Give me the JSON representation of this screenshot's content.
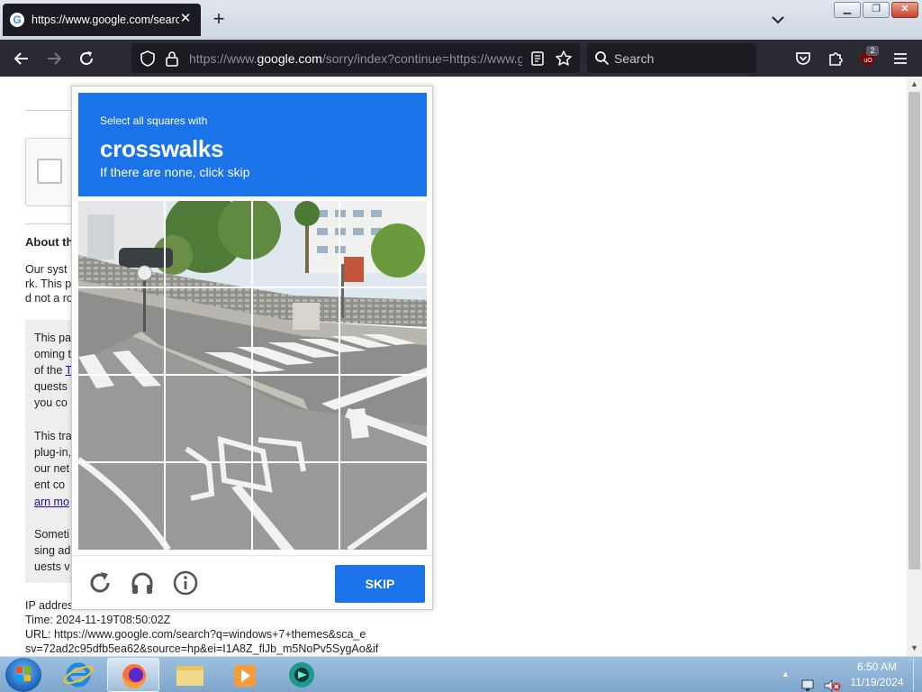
{
  "browser": {
    "tab": {
      "title": "https://www.google.com/search",
      "favicon": "G"
    },
    "url": {
      "prefix": "https://www.",
      "host": "google.com",
      "rest": "/sorry/index?continue=https://www.google.com/search"
    },
    "search_placeholder": "Search",
    "extension_badge": "2"
  },
  "page": {
    "heading": "About th",
    "para1": [
      "Our syst",
      "rk. This p",
      "d not a ro"
    ],
    "box_lines": [
      "This pa",
      "oming t",
      "of the ",
      "T",
      "quests",
      "you co",
      "",
      "This tra",
      "plug-in,",
      "our net",
      "ent co",
      "arn mo",
      "",
      "Someti",
      "sing ad",
      "uests v"
    ],
    "ip_line": "IP addres",
    "time_line": "Time: 2024-11-19T08:50:02Z",
    "url_line1": "URL: https://www.google.com/search?q=windows+7+themes&sca_e",
    "url_line2": "sv=72ad2c95dfb5ea62&source=hp&ei=I1A8Z_flJb_m5NoPv5SygAo&if"
  },
  "captcha": {
    "instruction_small": "Select all squares with",
    "target": "crosswalks",
    "hint": "If there are none, click skip",
    "skip_label": "SKIP",
    "grid_size": 4
  },
  "taskbar": {
    "time": "6:50 AM",
    "date": "11/19/2024"
  },
  "colors": {
    "accent": "#1a73e8",
    "toolbar": "#2b2a33",
    "urlbar": "#1c1b22"
  }
}
